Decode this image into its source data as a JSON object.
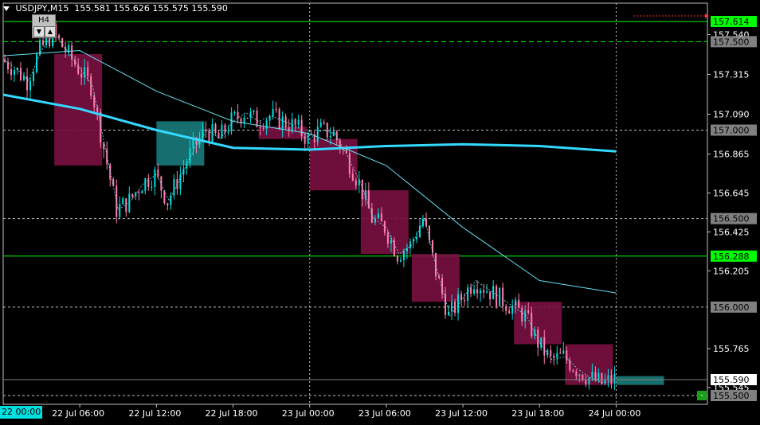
{
  "header": {
    "symbol": "USDJPY,M15",
    "open": "155.581",
    "high": "155.626",
    "low": "155.575",
    "close": "155.590"
  },
  "timeframe_box": {
    "label": "H4",
    "down": "▼",
    "up": "▲"
  },
  "small_button": "-",
  "first_date_label": "22 00:00",
  "colors": {
    "background": "#000000",
    "bull_candle": "#00e0e0",
    "bear_candle": "#ff7fb0",
    "h4_bear_box": "#7a1040",
    "h4_bull_box": "#1a7a7a",
    "ma_thick": "#33d9ff",
    "ma_thin": "#66e0f0",
    "level_line": "#00ff00",
    "grid": "#c0c0c0"
  },
  "chart_data": {
    "type": "candlestick",
    "title": "USDJPY,M15",
    "ylim": [
      155.5,
      157.614
    ],
    "y_ticks": [
      "157.540",
      "157.315",
      "157.090",
      "156.865",
      "156.645",
      "156.425",
      "156.205",
      "155.765",
      "155.545"
    ],
    "x_ticks": [
      "22 Jul 06:00",
      "22 Jul 12:00",
      "22 Jul 18:00",
      "23 Jul 00:00",
      "23 Jul 06:00",
      "23 Jul 12:00",
      "23 Jul 18:00",
      "24 Jul 00:00"
    ],
    "price_labels": [
      {
        "text": "157.614",
        "value": 157.614,
        "style": "green"
      },
      {
        "text": "157.500",
        "value": 157.5,
        "style": "gray"
      },
      {
        "text": "157.000",
        "value": 157.0,
        "style": "gray"
      },
      {
        "text": "156.500",
        "value": 156.5,
        "style": "gray"
      },
      {
        "text": "156.288",
        "value": 156.288,
        "style": "green"
      },
      {
        "text": "156.000",
        "value": 156.0,
        "style": "gray"
      },
      {
        "text": "155.590",
        "value": 155.59,
        "style": "white"
      },
      {
        "text": "155.500",
        "value": 155.5,
        "style": "gray"
      }
    ],
    "horizontal_levels": [
      {
        "value": 157.614,
        "kind": "green-solid"
      },
      {
        "value": 157.5,
        "kind": "green-dashed"
      },
      {
        "value": 157.0,
        "kind": "gray-dashed"
      },
      {
        "value": 156.5,
        "kind": "gray-dashed"
      },
      {
        "value": 156.288,
        "kind": "green-solid"
      },
      {
        "value": 156.0,
        "kind": "gray-dashed"
      },
      {
        "value": 155.5,
        "kind": "gray-dashed"
      }
    ],
    "period_separators": [
      "22 Jul 00:00",
      "23 Jul 00:00",
      "24 Jul 00:00"
    ],
    "h4_boxes": [
      {
        "time": "22 Jul 04:00",
        "open": 157.43,
        "close": 156.8,
        "dir": "bear"
      },
      {
        "time": "22 Jul 12:00",
        "open": 156.8,
        "close": 157.05,
        "dir": "bull"
      },
      {
        "time": "22 Jul 20:00",
        "open": 157.02,
        "close": 156.95,
        "dir": "bear"
      },
      {
        "time": "23 Jul 00:00",
        "open": 156.95,
        "close": 156.66,
        "dir": "bear"
      },
      {
        "time": "23 Jul 04:00",
        "open": 156.66,
        "close": 156.3,
        "dir": "bear"
      },
      {
        "time": "23 Jul 08:00",
        "open": 156.3,
        "close": 156.03,
        "dir": "bear"
      },
      {
        "time": "23 Jul 16:00",
        "open": 156.03,
        "close": 155.79,
        "dir": "bear"
      },
      {
        "time": "23 Jul 20:00",
        "open": 155.79,
        "close": 155.56,
        "dir": "bear"
      },
      {
        "time": "24 Jul 00:00",
        "open": 155.56,
        "close": 155.61,
        "dir": "bull"
      }
    ],
    "close_path": [
      [
        "22 Jul 00:00",
        157.4
      ],
      [
        "22 Jul 01:00",
        157.35
      ],
      [
        "22 Jul 02:00",
        157.28
      ],
      [
        "22 Jul 03:00",
        157.45
      ],
      [
        "22 Jul 04:00",
        157.55
      ],
      [
        "22 Jul 05:00",
        157.45
      ],
      [
        "22 Jul 06:00",
        157.35
      ],
      [
        "22 Jul 07:00",
        157.25
      ],
      [
        "22 Jul 08:00",
        156.9
      ],
      [
        "22 Jul 09:00",
        156.55
      ],
      [
        "22 Jul 10:00",
        156.6
      ],
      [
        "22 Jul 11:00",
        156.7
      ],
      [
        "22 Jul 12:00",
        156.75
      ],
      [
        "22 Jul 13:00",
        156.6
      ],
      [
        "22 Jul 14:00",
        156.75
      ],
      [
        "22 Jul 15:00",
        156.9
      ],
      [
        "22 Jul 16:00",
        157.0
      ],
      [
        "22 Jul 17:00",
        156.95
      ],
      [
        "22 Jul 18:00",
        157.05
      ],
      [
        "22 Jul 19:00",
        157.1
      ],
      [
        "22 Jul 20:00",
        157.05
      ],
      [
        "22 Jul 21:00",
        157.08
      ],
      [
        "22 Jul 22:00",
        157.05
      ],
      [
        "22 Jul 23:00",
        157.02
      ],
      [
        "23 Jul 00:00",
        156.95
      ],
      [
        "23 Jul 01:00",
        157.0
      ],
      [
        "23 Jul 02:00",
        156.98
      ],
      [
        "23 Jul 03:00",
        156.85
      ],
      [
        "23 Jul 04:00",
        156.7
      ],
      [
        "23 Jul 05:00",
        156.5
      ],
      [
        "23 Jul 06:00",
        156.45
      ],
      [
        "23 Jul 07:00",
        156.3
      ],
      [
        "23 Jul 08:00",
        156.35
      ],
      [
        "23 Jul 09:00",
        156.5
      ],
      [
        "23 Jul 10:00",
        156.2
      ],
      [
        "23 Jul 11:00",
        155.95
      ],
      [
        "23 Jul 12:00",
        156.05
      ],
      [
        "23 Jul 13:00",
        156.15
      ],
      [
        "23 Jul 14:00",
        156.1
      ],
      [
        "23 Jul 15:00",
        156.05
      ],
      [
        "23 Jul 16:00",
        156.0
      ],
      [
        "23 Jul 17:00",
        155.95
      ],
      [
        "23 Jul 18:00",
        155.8
      ],
      [
        "23 Jul 19:00",
        155.7
      ],
      [
        "23 Jul 20:00",
        155.72
      ],
      [
        "23 Jul 21:00",
        155.65
      ],
      [
        "23 Jul 22:00",
        155.6
      ],
      [
        "23 Jul 23:00",
        155.57
      ],
      [
        "24 Jul 00:00",
        155.59
      ]
    ],
    "ma_slow": [
      [
        "22 Jul 00:00",
        157.2
      ],
      [
        "22 Jul 06:00",
        157.12
      ],
      [
        "22 Jul 12:00",
        157.0
      ],
      [
        "22 Jul 18:00",
        156.9
      ],
      [
        "23 Jul 00:00",
        156.89
      ],
      [
        "23 Jul 06:00",
        156.91
      ],
      [
        "23 Jul 12:00",
        156.92
      ],
      [
        "23 Jul 18:00",
        156.91
      ],
      [
        "24 Jul 00:00",
        156.88
      ]
    ],
    "ma_fast": [
      [
        "22 Jul 00:00",
        157.42
      ],
      [
        "22 Jul 06:00",
        157.45
      ],
      [
        "22 Jul 12:00",
        157.22
      ],
      [
        "22 Jul 18:00",
        157.05
      ],
      [
        "23 Jul 00:00",
        156.98
      ],
      [
        "23 Jul 06:00",
        156.8
      ],
      [
        "23 Jul 12:00",
        156.45
      ],
      [
        "23 Jul 18:00",
        156.15
      ],
      [
        "24 Jul 00:00",
        156.08
      ]
    ]
  }
}
